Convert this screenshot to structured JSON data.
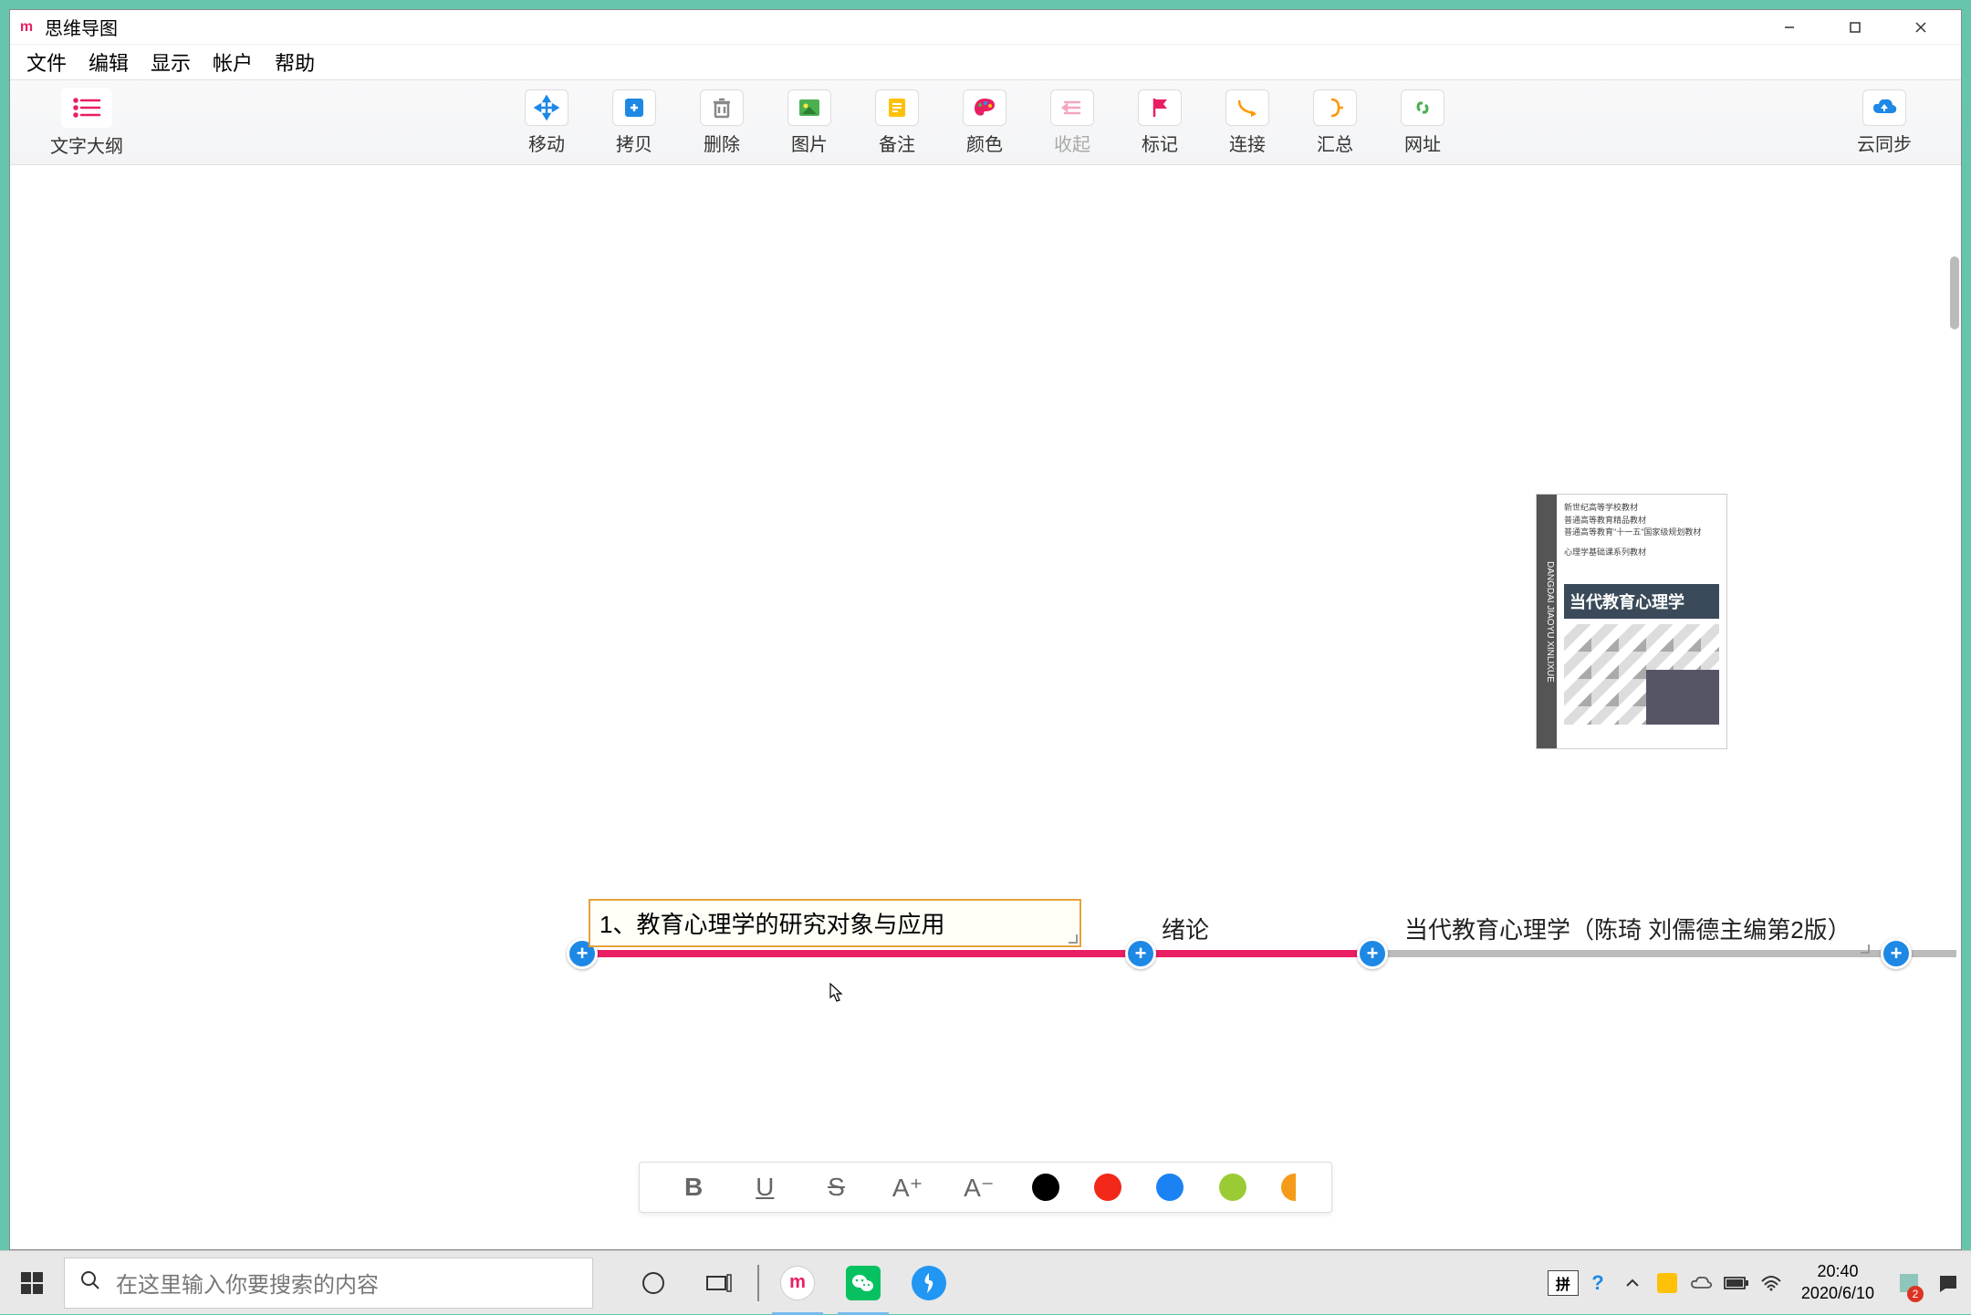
{
  "window": {
    "app_icon_letter": "m",
    "title": "思维导图"
  },
  "menu": {
    "file": "文件",
    "edit": "编辑",
    "view": "显示",
    "account": "帐户",
    "help": "帮助"
  },
  "toolbar": {
    "outline": "文字大纲",
    "move": "移动",
    "copy": "拷贝",
    "delete": "删除",
    "image": "图片",
    "note": "备注",
    "color": "颜色",
    "collapse": "收起",
    "flag": "标记",
    "connect": "连接",
    "summary": "汇总",
    "url": "网址",
    "sync": "云同步"
  },
  "nodes": {
    "editing_text": "1、教育心理学的研究对象与应用",
    "mid_label": "绪论",
    "root_label": "当代教育心理学（陈琦 刘儒德主编第2版）"
  },
  "book": {
    "line1": "新世纪高等学校教材",
    "line2": "普通高等教育精品教材",
    "line3": "普通高等教育\"十一五\"国家级规划教材",
    "line4": "心理学基础课系列教材",
    "title": "当代教育心理学",
    "spine": "DANGDAI JIAOYU XINLIXUE"
  },
  "format_bar": {
    "bold": "B",
    "underline": "U",
    "strike": "S",
    "larger": "A⁺",
    "smaller": "A⁻"
  },
  "colors": {
    "black": "#000000",
    "red": "#f2281a",
    "blue": "#1a82f2",
    "green": "#9acb34",
    "orange": "#f59b1a"
  },
  "taskbar": {
    "search_placeholder": "在这里输入你要搜索的内容",
    "ime": "拼",
    "time": "20:40",
    "date": "2020/6/10",
    "notif_count": "2"
  }
}
